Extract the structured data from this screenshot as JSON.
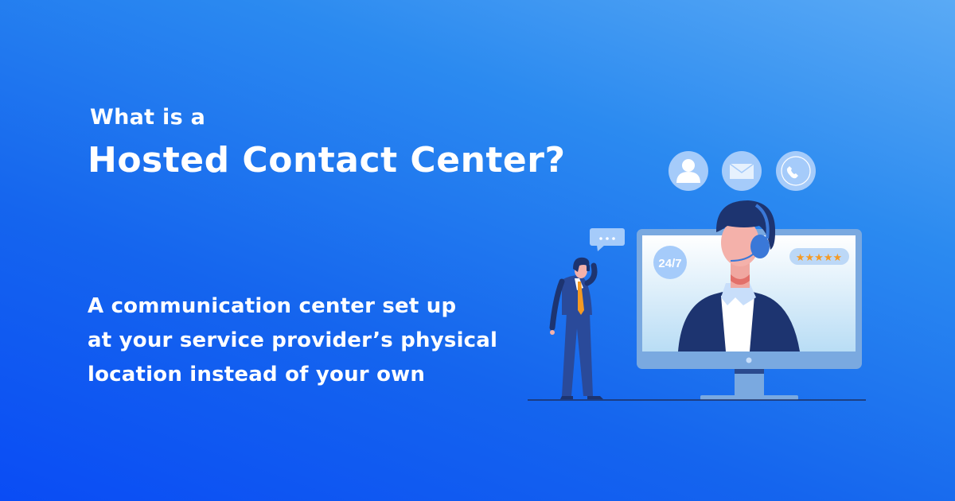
{
  "heading": {
    "pre": "What is a",
    "title": "Hosted Contact Center?"
  },
  "description": [
    "A communication center set up",
    "at your service provider’s physical",
    "location instead of your own"
  ],
  "illustration": {
    "badge_247": "24/7",
    "rating": "★★★★★",
    "icons": [
      "user-icon",
      "mail-icon",
      "phone-icon",
      "chat-bubble-icon"
    ]
  },
  "colors": {
    "accent": "#1565ee",
    "navy": "#1d3470",
    "star": "#f59a23"
  }
}
